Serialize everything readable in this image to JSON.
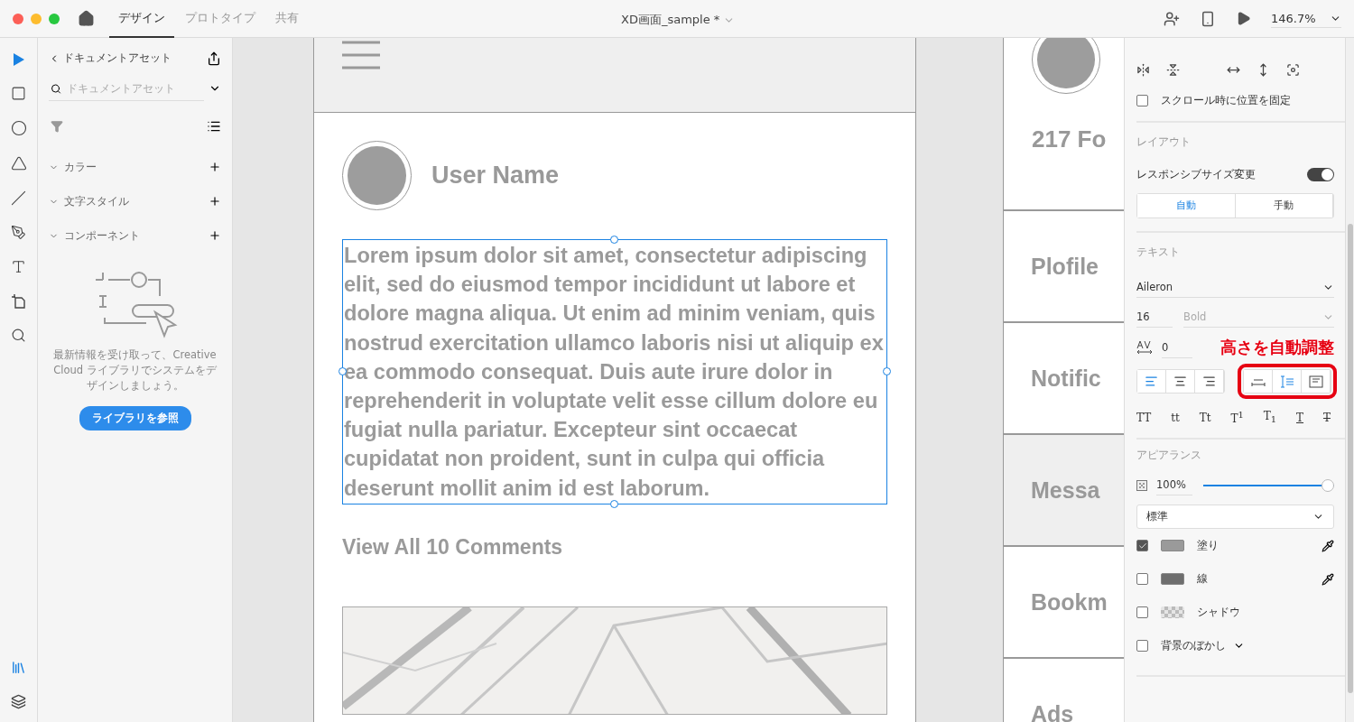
{
  "titlebar": {
    "tabs": [
      {
        "label": "デザイン",
        "selected": true
      },
      {
        "label": "プロトタイプ",
        "selected": false
      },
      {
        "label": "共有",
        "selected": false
      }
    ],
    "title": "XD画面_sample *",
    "zoom": "146.7%"
  },
  "toolbar": {
    "tools": [
      {
        "kind": "select",
        "selected": true
      },
      {
        "kind": "rectangle",
        "selected": false
      },
      {
        "kind": "ellipse",
        "selected": false
      },
      {
        "kind": "polygon",
        "selected": false
      },
      {
        "kind": "line",
        "selected": false
      },
      {
        "kind": "pen",
        "selected": false
      },
      {
        "kind": "text",
        "selected": false
      },
      {
        "kind": "artboard",
        "selected": false
      },
      {
        "kind": "zoom",
        "selected": false
      }
    ],
    "bottom": [
      {
        "kind": "assets",
        "selected": true
      },
      {
        "kind": "layers",
        "selected": false
      }
    ]
  },
  "assets_panel": {
    "title": "ドキュメントアセット",
    "search": {
      "placeholder": "ドキュメントアセット"
    },
    "sections": [
      {
        "label": "カラー",
        "expanded": true
      },
      {
        "label": "文字スタイル",
        "expanded": true
      },
      {
        "label": "コンポーネント",
        "expanded": true
      }
    ],
    "message": "最新情報を受け取って、Creative Cloud ライブラリでシステムをデザインしましょう。",
    "button": "ライブラリを参照"
  },
  "artboard_main": {
    "user_name": "User Name",
    "body": "Lorem ipsum dolor sit amet, consectetur adipiscing elit, sed do eiusmod tempor incididunt ut labore et dolore magna aliqua. Ut enim ad minim veniam, quis nostrud exercitation ullamco laboris nisi ut aliquip ex ea commodo consequat. Duis aute irure dolor in reprehenderit in voluptate velit esse cillum dolore eu fugiat nulla pariatur. Excepteur sint occaecat cupidatat non proident, sunt in culpa qui officia deserunt mollit anim id est laborum.",
    "comments_link": "View All 10 Comments"
  },
  "artboard_side": {
    "stat": "217 Fo",
    "menu": [
      {
        "label": "Plofile",
        "selected": false
      },
      {
        "label": "Notific",
        "selected": false
      },
      {
        "label": "Messa",
        "selected": true
      },
      {
        "label": "Bookm",
        "selected": false
      },
      {
        "label": "Ads",
        "selected": false
      }
    ]
  },
  "properties": {
    "pin": {
      "label": "スクロール時に位置を固定",
      "checked": false
    },
    "layout": {
      "heading": "レイアウト",
      "responsive": {
        "label": "レスポンシブサイズ変更",
        "on": true
      },
      "modes": [
        {
          "label": "自動",
          "selected": true
        },
        {
          "label": "手動",
          "selected": false
        }
      ]
    },
    "text": {
      "heading": "テキスト",
      "font": "Aileron",
      "size": "16",
      "weight": "Bold",
      "tracking": "0",
      "align": [
        {
          "kind": "left",
          "selected": true
        },
        {
          "kind": "center",
          "selected": false
        },
        {
          "kind": "right",
          "selected": false
        }
      ],
      "sizing": [
        {
          "kind": "auto-width",
          "selected": false
        },
        {
          "kind": "auto-height",
          "selected": true
        },
        {
          "kind": "fixed",
          "selected": false
        }
      ],
      "styles": [
        {
          "label": "TT",
          "kind": "plain"
        },
        {
          "label": "tt",
          "kind": "plain"
        },
        {
          "label": "Tt",
          "kind": "plain"
        },
        {
          "label": "T$^{1}$",
          "kind": "plain"
        },
        {
          "label": "T$_{1}$",
          "kind": "plain"
        },
        {
          "label": "T",
          "kind": "underline"
        },
        {
          "label": "T",
          "kind": "strike"
        }
      ]
    },
    "annotation": "高さを自動調整",
    "appearance": {
      "heading": "アピアランス",
      "opacity": "100%",
      "opacity_slider": {
        "level": 1
      },
      "blend": "標準",
      "rows": [
        {
          "kind": "fill",
          "label": "塗り",
          "checked": true,
          "color": "#9a9a9a"
        },
        {
          "kind": "stroke",
          "label": "線",
          "checked": false,
          "color": "#6e6e6e"
        },
        {
          "kind": "shadow",
          "label": "シャドウ",
          "checked": false
        },
        {
          "kind": "blur",
          "label": "背景のぼかし",
          "checked": false
        }
      ]
    }
  }
}
